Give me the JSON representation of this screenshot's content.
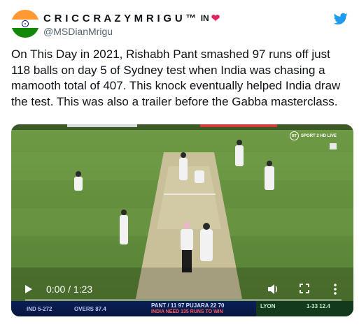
{
  "user": {
    "display_name": "C R I C C R A Z Y M R I G U ™",
    "flag_text": "IN",
    "heart": "❤",
    "handle": "@MSDianMrigu"
  },
  "icons": {
    "avatar": "india-flag-avatar",
    "brand": "twitter-bird-icon",
    "play": "play-icon",
    "volume": "volume-icon",
    "fullscreen": "fullscreen-icon",
    "more": "more-vertical-icon"
  },
  "tweet": {
    "text": "On This Day in 2021, Rishabh Pant smashed 97 runs off just 118 balls on day 5 of Sydney test when India was chasing a mamooth total of 407. This knock eventually helped India draw the test. This was also a trailer before the Gabba masterclass."
  },
  "video": {
    "broadcaster": "SPORT 2 HD LIVE",
    "broadcaster_mark": "BT",
    "time": "0:00 / 1:23",
    "progress_fraction": 0.0,
    "scorebar": {
      "team_score": "IND  5-272",
      "overs": "OVERS 87.4",
      "batters": "PANT  / 11 97     PUJARA   22 70",
      "need": "INDIA NEED 135 RUNS TO WIN",
      "bowler": "LYON",
      "bowler_figures": "1-33 12.4"
    }
  },
  "colors": {
    "accent": "#1d9bf0",
    "heart": "#e0245e",
    "handle": "#536471"
  }
}
